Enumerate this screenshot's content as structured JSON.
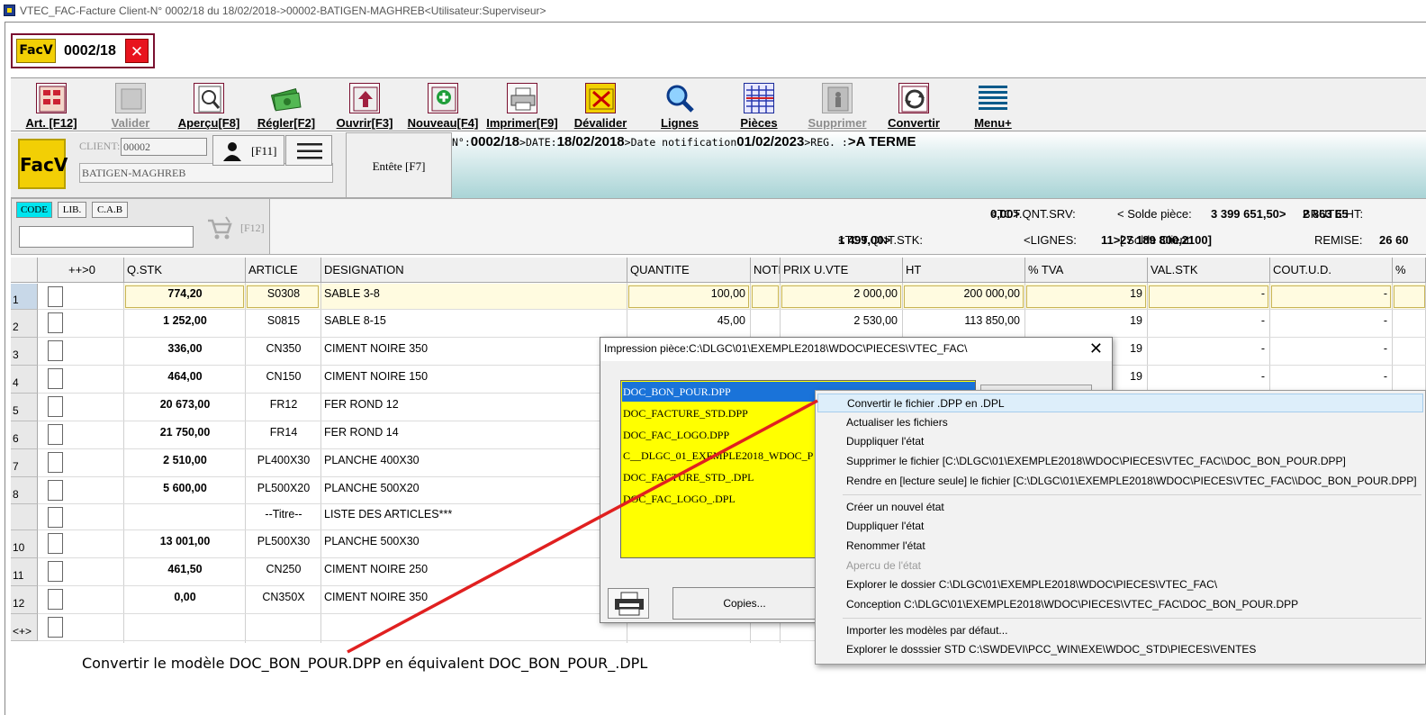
{
  "window": {
    "title": "VTEC_FAC-Facture Client-N° 0002/18 du 18/02/2018->00002-BATIGEN-MAGHREB<Utilisateur:Superviseur>"
  },
  "piece_tab": {
    "logo": "FacV",
    "number": "0002/18",
    "close": "✕"
  },
  "toolbar": [
    {
      "label": "Art. [F12]",
      "icon": "article-icon",
      "disabled": false
    },
    {
      "label": "Valider",
      "icon": "validate-icon",
      "disabled": true
    },
    {
      "label": "Aperçu[F8]",
      "icon": "preview-icon",
      "disabled": false
    },
    {
      "label": "Régler[F2]",
      "icon": "money-icon",
      "disabled": false
    },
    {
      "label": "Ouvrir[F3]",
      "icon": "open-icon",
      "disabled": false
    },
    {
      "label": "Nouveau[F4]",
      "icon": "new-icon",
      "disabled": false
    },
    {
      "label": "Imprimer[F9]",
      "icon": "printer-icon",
      "disabled": false
    },
    {
      "label": "Dévalider",
      "icon": "unvalidate-icon",
      "disabled": false
    },
    {
      "label": "Lignes",
      "icon": "magnifier-icon",
      "disabled": false
    },
    {
      "label": "Pièces",
      "icon": "grid-icon",
      "disabled": false
    },
    {
      "label": "Supprimer",
      "icon": "trash-icon",
      "disabled": true
    },
    {
      "label": "Convertir",
      "icon": "convert-icon",
      "disabled": false
    },
    {
      "label": "Menu+",
      "icon": "menu-icon",
      "disabled": false
    }
  ],
  "header": {
    "logo": "FacV",
    "client_label": "CLIENT:",
    "client_code": "00002",
    "client_name": "BATIGEN-MAGHREB",
    "user_key": "[F11]",
    "entete": "Entête [F7]",
    "info": {
      "n_label": "N°:",
      "n_value": "0002/18",
      "date_label": ">DATE:",
      "date_value": "18/02/2018",
      "notif_label": ">Date notification",
      "notif_value": "01/02/2023",
      "reg_label": ">REG. :",
      "reg_value": ">A TERME"
    }
  },
  "search": {
    "modes": [
      "CODE",
      "LIB.",
      "C.A.B"
    ],
    "active_mode": "CODE",
    "input_value": "",
    "key": "[F12]"
  },
  "totals": {
    "tot_srv_label": "<TOT.QNT.SRV:",
    "tot_srv_value": "0,00>",
    "solde_piece_label": "< Solde pièce:",
    "solde_piece_value": "3 399 651,50>",
    "brute_label": "BRUTE HT:",
    "brute_value": "2 863 65",
    "tot_stk_label": "<TOT.QNT.STK:",
    "tot_stk_value": "1 499,00>",
    "lignes_label": "<LIGNES:",
    "lignes_value": "11>",
    "solde_client_label": "[ Solde Client:",
    "solde_client_value": "27 189 800,2100]",
    "remise_label": "REMISE:",
    "remise_value": "26 60"
  },
  "table": {
    "columns": [
      "++>0",
      "Q.STK",
      "ARTICLE",
      "DESIGNATION",
      "QUANTITE",
      "NOTE",
      "PRIX U.VTE",
      "HT",
      "% TVA",
      "VAL.STK",
      "COUT.U.D.",
      "%"
    ],
    "rows": [
      {
        "num": "1",
        "qstk": "774,20",
        "article": "S0308",
        "designation": "SABLE 3-8",
        "quantite": "100,00",
        "prix": "2 000,00",
        "ht": "200 000,00",
        "tva": "19",
        "valstk": "-",
        "cout": "-"
      },
      {
        "num": "2",
        "qstk": "1 252,00",
        "article": "S0815",
        "designation": "SABLE 8-15",
        "quantite": "45,00",
        "prix": "2 530,00",
        "ht": "113 850,00",
        "tva": "19",
        "valstk": "-",
        "cout": "-"
      },
      {
        "num": "3",
        "qstk": "336,00",
        "article": "CN350",
        "designation": "CIMENT NOIRE 350",
        "quantite": "",
        "prix": "",
        "ht": "",
        "tva": "19",
        "valstk": "-",
        "cout": "-"
      },
      {
        "num": "4",
        "qstk": "464,00",
        "article": "CN150",
        "designation": "CIMENT NOIRE 150",
        "quantite": "",
        "prix": "",
        "ht": "",
        "tva": "19",
        "valstk": "-",
        "cout": "-"
      },
      {
        "num": "5",
        "qstk": "20 673,00",
        "article": "FR12",
        "designation": "FER ROND 12",
        "quantite": "",
        "prix": "",
        "ht": "",
        "tva": "",
        "valstk": "",
        "cout": ""
      },
      {
        "num": "6",
        "qstk": "21 750,00",
        "article": "FR14",
        "designation": "FER ROND 14",
        "quantite": "",
        "prix": "",
        "ht": "",
        "tva": "",
        "valstk": "",
        "cout": ""
      },
      {
        "num": "7",
        "qstk": "2 510,00",
        "article": "PL400X30",
        "designation": "PLANCHE 400X30",
        "quantite": "",
        "prix": "",
        "ht": "",
        "tva": "",
        "valstk": "",
        "cout": ""
      },
      {
        "num": "8",
        "qstk": "5 600,00",
        "article": "PL500X20",
        "designation": "PLANCHE 500X20",
        "quantite": "",
        "prix": "",
        "ht": "",
        "tva": "",
        "valstk": "",
        "cout": ""
      },
      {
        "num": "",
        "qstk": "",
        "article": "--Titre--",
        "designation": "LISTE DES ARTICLES***",
        "quantite": "",
        "prix": "",
        "ht": "",
        "tva": "",
        "valstk": "",
        "cout": ""
      },
      {
        "num": "10",
        "qstk": "13 001,00",
        "article": "PL500X30",
        "designation": "PLANCHE 500X30",
        "quantite": "",
        "prix": "",
        "ht": "",
        "tva": "",
        "valstk": "",
        "cout": ""
      },
      {
        "num": "11",
        "qstk": "461,50",
        "article": "CN250",
        "designation": "CIMENT NOIRE 250",
        "quantite": "",
        "prix": "",
        "ht": "",
        "tva": "",
        "valstk": "",
        "cout": ""
      },
      {
        "num": "12",
        "qstk": "0,00",
        "article": "CN350X",
        "designation": "CIMENT NOIRE 350",
        "quantite": "",
        "prix": "",
        "ht": "",
        "tva": "",
        "valstk": "",
        "cout": ""
      },
      {
        "num": "<+>",
        "qstk": "",
        "article": "",
        "designation": "",
        "quantite": "",
        "prix": "",
        "ht": "",
        "tva": "",
        "valstk": "",
        "cout": ""
      }
    ]
  },
  "dialog": {
    "title": "Impression pièce:C:\\DLGC\\01\\EXEMPLE2018\\WDOC\\PIECES\\VTEC_FAC\\",
    "close": "✕",
    "files": [
      "DOC_BON_POUR.DPP",
      "DOC_FACTURE_STD.DPP",
      "DOC_FAC_LOGO.DPP",
      "C__DLGC_01_EXEMPLE2018_WDOC_P",
      "DOC_FACTURE_STD_.DPL",
      "DOC_FAC_LOGO_.DPL"
    ],
    "selected_index": 0,
    "copies_label": "Copies..."
  },
  "context_menu": [
    {
      "label": "Convertir le fichier .DPP en .DPL",
      "state": "highlight"
    },
    {
      "label": "Actualiser les fichiers",
      "state": "normal"
    },
    {
      "label": "Duppliquer l'état",
      "state": "normal"
    },
    {
      "label": "Supprimer le fichier [C:\\DLGC\\01\\EXEMPLE2018\\WDOC\\PIECES\\VTEC_FAC\\\\DOC_BON_POUR.DPP]",
      "state": "normal"
    },
    {
      "label": "Rendre en [lecture seule] le fichier [C:\\DLGC\\01\\EXEMPLE2018\\WDOC\\PIECES\\VTEC_FAC\\\\DOC_BON_POUR.DPP]",
      "state": "normal"
    },
    {
      "label": "Créer un nouvel état",
      "state": "normal",
      "sep_before": true
    },
    {
      "label": "Duppliquer l'état",
      "state": "normal"
    },
    {
      "label": "Renommer l'état",
      "state": "normal"
    },
    {
      "label": "Apercu de l'état",
      "state": "disabled"
    },
    {
      "label": "Explorer le dossier C:\\DLGC\\01\\EXEMPLE2018\\WDOC\\PIECES\\VTEC_FAC\\",
      "state": "normal"
    },
    {
      "label": "Conception C:\\DLGC\\01\\EXEMPLE2018\\WDOC\\PIECES\\VTEC_FAC\\DOC_BON_POUR.DPP",
      "state": "normal"
    },
    {
      "label": "Importer les modèles par défaut...",
      "state": "normal",
      "sep_before": true
    },
    {
      "label": "Explorer le dosssier STD C:\\SWDEVI\\PCC_WIN\\EXE\\WDOC_STD\\PIECES\\VENTES",
      "state": "normal"
    }
  ],
  "annotation": {
    "text": "Convertir le modèle DOC_BON_POUR.DPP en équivalent DOC_BON_POUR_.DPL",
    "line_color": "#e02020"
  }
}
